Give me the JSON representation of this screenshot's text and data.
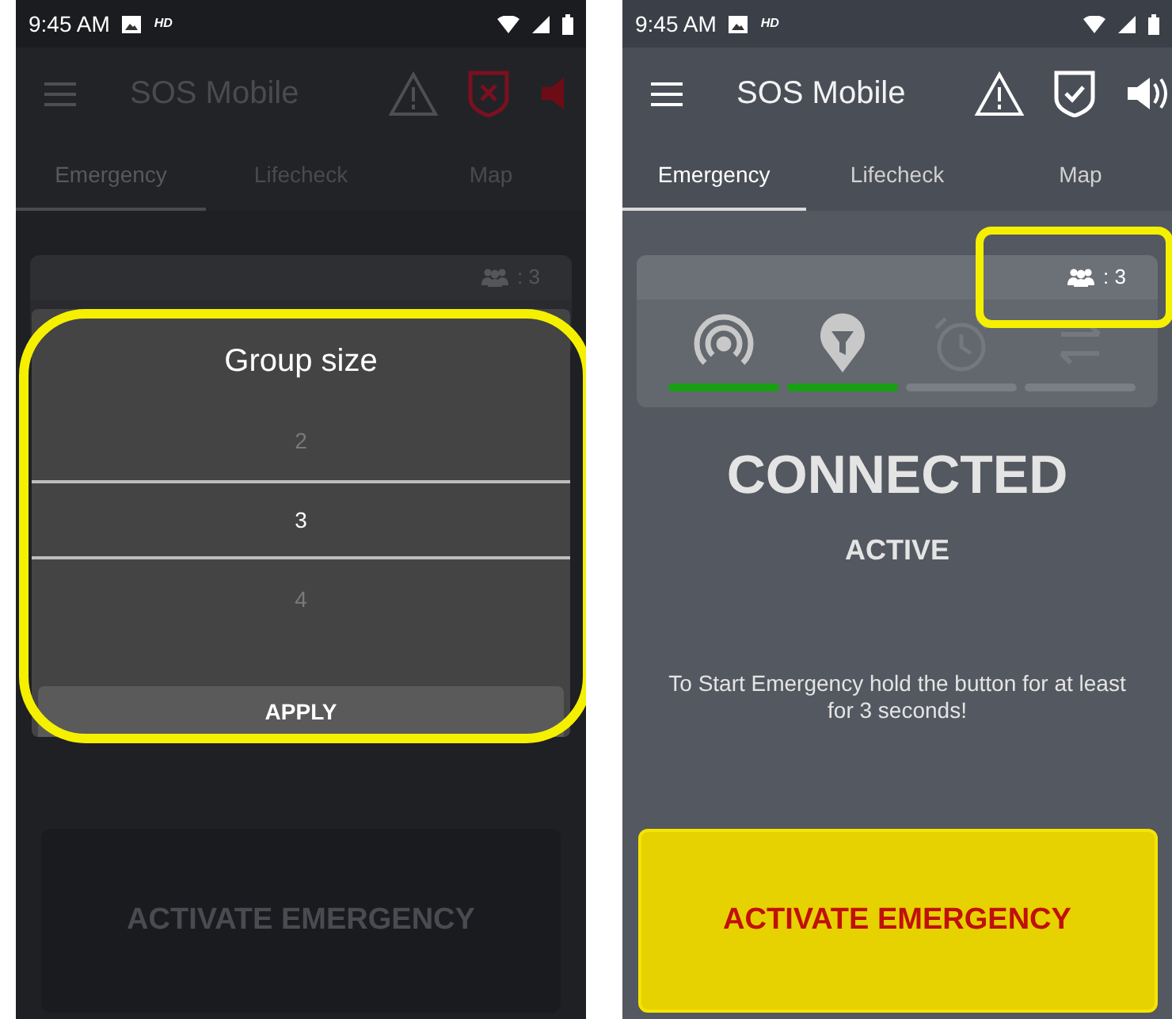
{
  "screens": [
    {
      "dimmed": true,
      "status_bar": {
        "time": "9:45 AM",
        "badge": "HD"
      },
      "app_bar": {
        "title": "SOS Mobile",
        "protected": false,
        "sound_on": false
      },
      "tabs": [
        {
          "label": "Emergency",
          "selected": true
        },
        {
          "label": "Lifecheck",
          "selected": false
        },
        {
          "label": "Map",
          "selected": false
        }
      ],
      "group_count": {
        "text": ": 3",
        "highlighted": false
      },
      "dialog": {
        "title": "Group size",
        "highlighted": true,
        "options": [
          {
            "label": "2",
            "selected": false
          },
          {
            "label": "3",
            "selected": true
          },
          {
            "label": "4",
            "selected": false
          }
        ],
        "apply": "APPLY"
      },
      "activate_button": "ACTIVATE EMERGENCY"
    },
    {
      "dimmed": false,
      "status_bar": {
        "time": "9:45 AM",
        "badge": "HD"
      },
      "app_bar": {
        "title": "SOS Mobile",
        "protected": true,
        "sound_on": true
      },
      "tabs": [
        {
          "label": "Emergency",
          "selected": true
        },
        {
          "label": "Lifecheck",
          "selected": false
        },
        {
          "label": "Map",
          "selected": false
        }
      ],
      "group_count": {
        "text": ": 3",
        "highlighted": true
      },
      "indicators": [
        {
          "kind": "signal",
          "on": true
        },
        {
          "kind": "location",
          "on": true
        },
        {
          "kind": "alarm",
          "on": false
        },
        {
          "kind": "transfer",
          "on": false
        }
      ],
      "connection": "CONNECTED",
      "state": "ACTIVE",
      "instructions": "To Start Emergency hold the button for at least for 3 seconds!",
      "activate_button": "ACTIVATE EMERGENCY"
    }
  ]
}
